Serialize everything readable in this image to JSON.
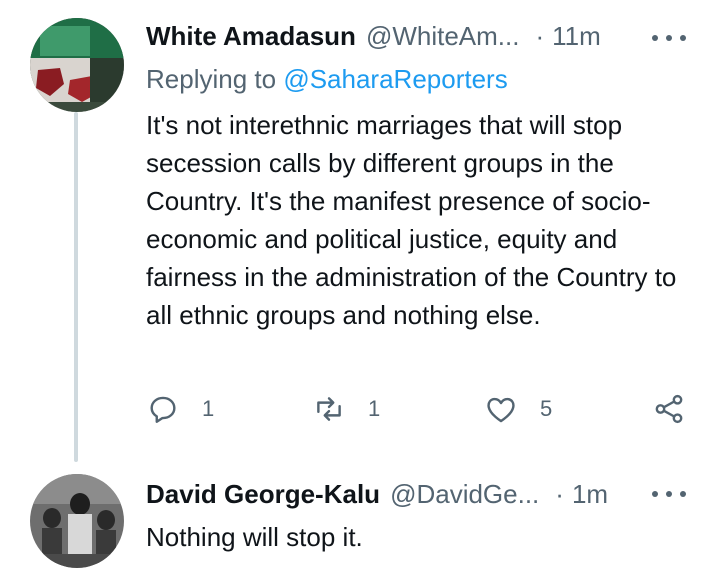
{
  "thread": [
    {
      "display_name": "White Amadasun",
      "handle": "@WhiteAm...",
      "dot": "·",
      "time": "11m",
      "replying_prefix": "Replying to",
      "replying_to": "@SaharaReporters",
      "text": "It's not interethnic marriages that will stop secession calls by different groups in the Country. It's the manifest presence of socio-economic and political justice, equity and fairness in the administration of the Country to all ethnic groups and nothing else.",
      "actions": {
        "reply_count": "1",
        "retweet_count": "1",
        "like_count": "5"
      }
    },
    {
      "display_name": "David George-Kalu",
      "handle": "@DavidGe...",
      "dot": "·",
      "time": "1m",
      "text": "Nothing will stop it."
    }
  ],
  "colors": {
    "text": "#0f1419",
    "secondary": "#536471",
    "link": "#1d9bf0",
    "thread_line": "#cfd9de"
  },
  "icons": [
    "more-icon",
    "reply-icon",
    "retweet-icon",
    "like-icon",
    "share-icon"
  ]
}
